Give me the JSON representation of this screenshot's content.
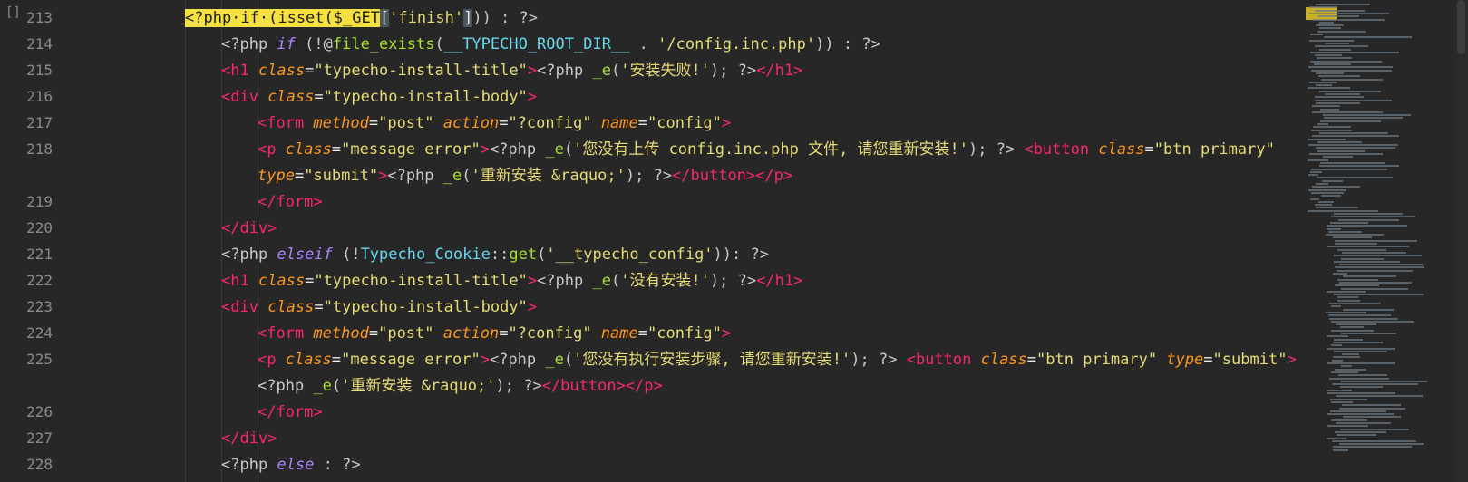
{
  "gutter": {
    "fold_marker": "[]",
    "line_numbers": [
      "213",
      "214",
      "215",
      "216",
      "217",
      "218",
      "219",
      "220",
      "221",
      "222",
      "223",
      "224",
      "225",
      "226",
      "227",
      "228"
    ]
  },
  "code": {
    "lines": [
      {
        "num": "213",
        "indent": 0,
        "parts": [
          {
            "t": "<?php·if·(isset($_GET",
            "c": "hl"
          },
          {
            "t": "[",
            "c": "sel"
          },
          {
            "t": "'finish'",
            "c": "str"
          },
          {
            "t": "]",
            "c": "sel"
          },
          {
            "t": ")) : ?>",
            "c": "php"
          }
        ]
      },
      {
        "num": "214",
        "indent": 1,
        "parts": [
          {
            "t": "<?php ",
            "c": "php"
          },
          {
            "t": "if",
            "c": "kw"
          },
          {
            "t": " (!@",
            "c": "php"
          },
          {
            "t": "file_exists",
            "c": "fn"
          },
          {
            "t": "(",
            "c": "php"
          },
          {
            "t": "__TYPECHO_ROOT_DIR__",
            "c": "cls"
          },
          {
            "t": " . ",
            "c": "php"
          },
          {
            "t": "'/config.inc.php'",
            "c": "str"
          },
          {
            "t": ")) : ?>",
            "c": "php"
          }
        ]
      },
      {
        "num": "215",
        "indent": 1,
        "parts": [
          {
            "t": "<h1 ",
            "c": "tag"
          },
          {
            "t": "class",
            "c": "attr"
          },
          {
            "t": "=",
            "c": "plain"
          },
          {
            "t": "\"typecho-install-title\"",
            "c": "str"
          },
          {
            "t": ">",
            "c": "tag"
          },
          {
            "t": "<?php ",
            "c": "php"
          },
          {
            "t": "_e",
            "c": "fn"
          },
          {
            "t": "(",
            "c": "php"
          },
          {
            "t": "'安装失败!'",
            "c": "str"
          },
          {
            "t": "); ?>",
            "c": "php"
          },
          {
            "t": "</h1>",
            "c": "tag"
          }
        ]
      },
      {
        "num": "216",
        "indent": 1,
        "parts": [
          {
            "t": "<div ",
            "c": "tag"
          },
          {
            "t": "class",
            "c": "attr"
          },
          {
            "t": "=",
            "c": "plain"
          },
          {
            "t": "\"typecho-install-body\"",
            "c": "str"
          },
          {
            "t": ">",
            "c": "tag"
          }
        ]
      },
      {
        "num": "217",
        "indent": 2,
        "parts": [
          {
            "t": "<form ",
            "c": "tag"
          },
          {
            "t": "method",
            "c": "attr"
          },
          {
            "t": "=",
            "c": "plain"
          },
          {
            "t": "\"post\"",
            "c": "str"
          },
          {
            "t": " ",
            "c": "plain"
          },
          {
            "t": "action",
            "c": "attr"
          },
          {
            "t": "=",
            "c": "plain"
          },
          {
            "t": "\"?config\"",
            "c": "str"
          },
          {
            "t": " ",
            "c": "plain"
          },
          {
            "t": "name",
            "c": "attr"
          },
          {
            "t": "=",
            "c": "plain"
          },
          {
            "t": "\"config\"",
            "c": "str"
          },
          {
            "t": ">",
            "c": "tag"
          }
        ]
      },
      {
        "num": "218",
        "indent": 2,
        "parts": [
          {
            "t": "<p ",
            "c": "tag"
          },
          {
            "t": "class",
            "c": "attr"
          },
          {
            "t": "=",
            "c": "plain"
          },
          {
            "t": "\"message error\"",
            "c": "str"
          },
          {
            "t": ">",
            "c": "tag"
          },
          {
            "t": "<?php ",
            "c": "php"
          },
          {
            "t": "_e",
            "c": "fn"
          },
          {
            "t": "(",
            "c": "php"
          },
          {
            "t": "'您没有上传 config.inc.php 文件, 请您重新安装!'",
            "c": "str"
          },
          {
            "t": "); ?> ",
            "c": "php"
          },
          {
            "t": "<button ",
            "c": "tag"
          },
          {
            "t": "class",
            "c": "attr"
          },
          {
            "t": "=",
            "c": "plain"
          },
          {
            "t": "\"btn primary\"",
            "c": "str"
          }
        ]
      },
      {
        "num": "",
        "indent": 2,
        "parts": [
          {
            "t": "type",
            "c": "attr"
          },
          {
            "t": "=",
            "c": "plain"
          },
          {
            "t": "\"submit\"",
            "c": "str"
          },
          {
            "t": ">",
            "c": "tag"
          },
          {
            "t": "<?php ",
            "c": "php"
          },
          {
            "t": "_e",
            "c": "fn"
          },
          {
            "t": "(",
            "c": "php"
          },
          {
            "t": "'重新安装 &raquo;'",
            "c": "str"
          },
          {
            "t": "); ?>",
            "c": "php"
          },
          {
            "t": "</button></p>",
            "c": "tag"
          }
        ]
      },
      {
        "num": "219",
        "indent": 2,
        "parts": [
          {
            "t": "</form>",
            "c": "tag"
          }
        ]
      },
      {
        "num": "220",
        "indent": 1,
        "parts": [
          {
            "t": "</div>",
            "c": "tag"
          }
        ]
      },
      {
        "num": "221",
        "indent": 1,
        "parts": [
          {
            "t": "<?php ",
            "c": "php"
          },
          {
            "t": "elseif",
            "c": "kw"
          },
          {
            "t": " (!",
            "c": "php"
          },
          {
            "t": "Typecho_Cookie",
            "c": "cls"
          },
          {
            "t": "::",
            "c": "php"
          },
          {
            "t": "get",
            "c": "fn"
          },
          {
            "t": "(",
            "c": "php"
          },
          {
            "t": "'__typecho_config'",
            "c": "str"
          },
          {
            "t": ")): ?>",
            "c": "php"
          }
        ]
      },
      {
        "num": "222",
        "indent": 1,
        "parts": [
          {
            "t": "<h1 ",
            "c": "tag"
          },
          {
            "t": "class",
            "c": "attr"
          },
          {
            "t": "=",
            "c": "plain"
          },
          {
            "t": "\"typecho-install-title\"",
            "c": "str"
          },
          {
            "t": ">",
            "c": "tag"
          },
          {
            "t": "<?php ",
            "c": "php"
          },
          {
            "t": "_e",
            "c": "fn"
          },
          {
            "t": "(",
            "c": "php"
          },
          {
            "t": "'没有安装!'",
            "c": "str"
          },
          {
            "t": "); ?>",
            "c": "php"
          },
          {
            "t": "</h1>",
            "c": "tag"
          }
        ]
      },
      {
        "num": "223",
        "indent": 1,
        "parts": [
          {
            "t": "<div ",
            "c": "tag"
          },
          {
            "t": "class",
            "c": "attr"
          },
          {
            "t": "=",
            "c": "plain"
          },
          {
            "t": "\"typecho-install-body\"",
            "c": "str"
          },
          {
            "t": ">",
            "c": "tag"
          }
        ]
      },
      {
        "num": "224",
        "indent": 2,
        "parts": [
          {
            "t": "<form ",
            "c": "tag"
          },
          {
            "t": "method",
            "c": "attr"
          },
          {
            "t": "=",
            "c": "plain"
          },
          {
            "t": "\"post\"",
            "c": "str"
          },
          {
            "t": " ",
            "c": "plain"
          },
          {
            "t": "action",
            "c": "attr"
          },
          {
            "t": "=",
            "c": "plain"
          },
          {
            "t": "\"?config\"",
            "c": "str"
          },
          {
            "t": " ",
            "c": "plain"
          },
          {
            "t": "name",
            "c": "attr"
          },
          {
            "t": "=",
            "c": "plain"
          },
          {
            "t": "\"config\"",
            "c": "str"
          },
          {
            "t": ">",
            "c": "tag"
          }
        ]
      },
      {
        "num": "225",
        "indent": 2,
        "parts": [
          {
            "t": "<p ",
            "c": "tag"
          },
          {
            "t": "class",
            "c": "attr"
          },
          {
            "t": "=",
            "c": "plain"
          },
          {
            "t": "\"message error\"",
            "c": "str"
          },
          {
            "t": ">",
            "c": "tag"
          },
          {
            "t": "<?php ",
            "c": "php"
          },
          {
            "t": "_e",
            "c": "fn"
          },
          {
            "t": "(",
            "c": "php"
          },
          {
            "t": "'您没有执行安装步骤, 请您重新安装!'",
            "c": "str"
          },
          {
            "t": "); ?> ",
            "c": "php"
          },
          {
            "t": "<button ",
            "c": "tag"
          },
          {
            "t": "class",
            "c": "attr"
          },
          {
            "t": "=",
            "c": "plain"
          },
          {
            "t": "\"btn primary\"",
            "c": "str"
          },
          {
            "t": " ",
            "c": "plain"
          },
          {
            "t": "type",
            "c": "attr"
          },
          {
            "t": "=",
            "c": "plain"
          },
          {
            "t": "\"submit\"",
            "c": "str"
          },
          {
            "t": ">",
            "c": "tag"
          }
        ]
      },
      {
        "num": "",
        "indent": 2,
        "parts": [
          {
            "t": "<?php ",
            "c": "php"
          },
          {
            "t": "_e",
            "c": "fn"
          },
          {
            "t": "(",
            "c": "php"
          },
          {
            "t": "'重新安装 &raquo;'",
            "c": "str"
          },
          {
            "t": "); ?>",
            "c": "php"
          },
          {
            "t": "</button></p>",
            "c": "tag"
          }
        ]
      },
      {
        "num": "226",
        "indent": 2,
        "parts": [
          {
            "t": "</form>",
            "c": "tag"
          }
        ]
      },
      {
        "num": "227",
        "indent": 1,
        "parts": [
          {
            "t": "</div>",
            "c": "tag"
          }
        ]
      },
      {
        "num": "228",
        "indent": 1,
        "parts": [
          {
            "t": "<?php ",
            "c": "php"
          },
          {
            "t": "else",
            "c": "kw"
          },
          {
            "t": " : ?>",
            "c": "php"
          }
        ]
      }
    ]
  },
  "colors": {
    "background": "#272727",
    "highlight": "#f5e042",
    "tag": "#f92672",
    "attribute": "#fd971f",
    "string": "#e6db74",
    "keyword": "#ae81ff",
    "function": "#a6e22e"
  }
}
